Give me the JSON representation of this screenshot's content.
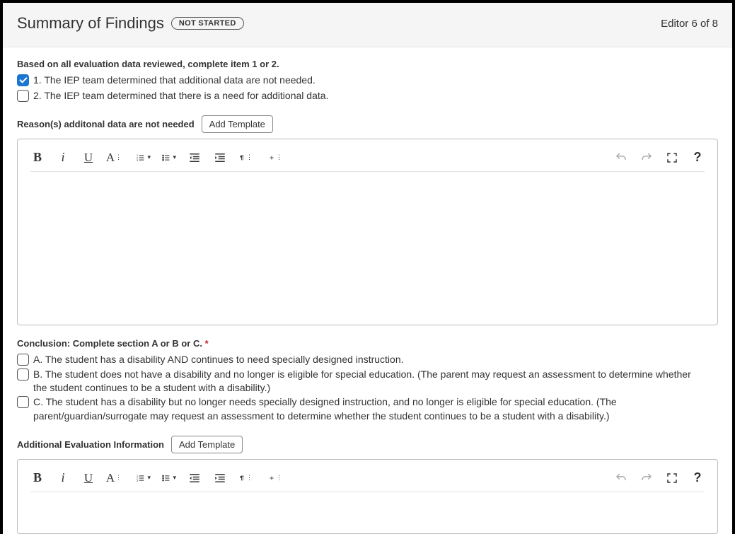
{
  "header": {
    "title": "Summary of Findings",
    "status": "NOT STARTED",
    "counter": "Editor 6 of 8"
  },
  "intro": "Based on all evaluation data reviewed, complete item 1 or 2.",
  "items": [
    {
      "label": "1. The IEP team determined that additional data are not needed.",
      "checked": true
    },
    {
      "label": "2. The IEP team determined that there is a need for additional data.",
      "checked": false
    }
  ],
  "reason": {
    "label": "Reason(s) additonal data are not needed",
    "add_template": "Add Template"
  },
  "conclusion": {
    "label": "Conclusion: Complete section A or B or C.",
    "options": [
      {
        "line1": "A. The student has a disability AND continues to need specially designed instruction.",
        "line2": ""
      },
      {
        "line1": "B. The student does not have a disability and no longer is eligible for special education. (The parent may request an assessment to determine whether",
        "line2": "the student continues to be a student with a disability.)"
      },
      {
        "line1": "C. The student has a disability but no longer needs specially designed instruction, and no longer is eligible for special education. (The",
        "line2": "parent/guardian/surrogate may request an assessment to determine whether the student continues to be a student with a disability.)"
      }
    ]
  },
  "additional": {
    "label": "Additional Evaluation Information",
    "add_template": "Add Template"
  },
  "toolbar_glyphs": {
    "help": "?"
  }
}
